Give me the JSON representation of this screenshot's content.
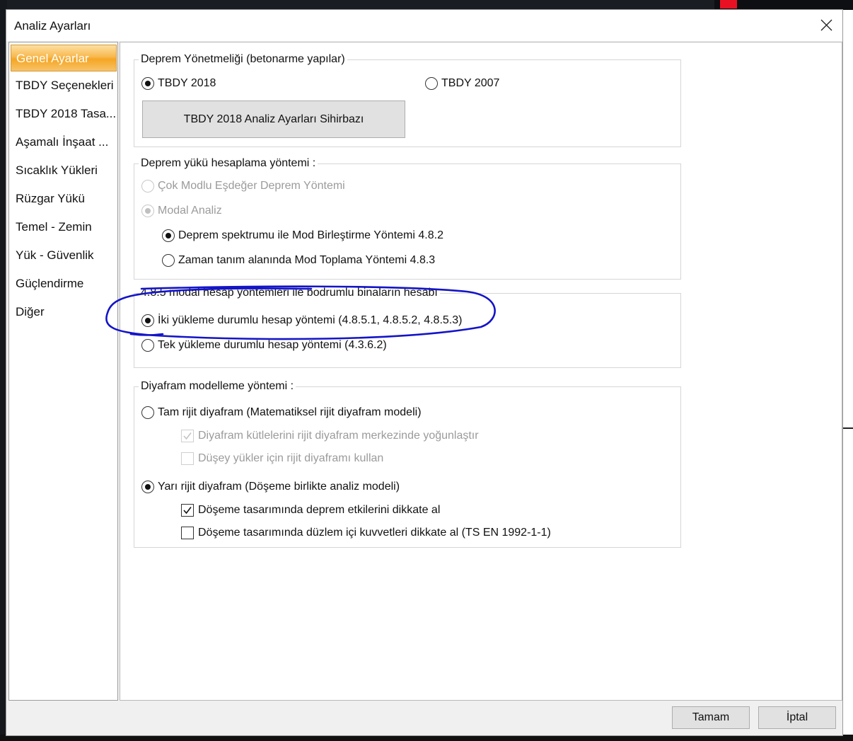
{
  "dialog": {
    "title": "Analiz Ayarları"
  },
  "sidebar": {
    "items": [
      {
        "label": "Genel Ayarlar",
        "active": true
      },
      {
        "label": "TBDY Seçenekleri"
      },
      {
        "label": "TBDY 2018 Tasa..."
      },
      {
        "label": "Aşamalı İnşaat ..."
      },
      {
        "label": "Sıcaklık Yükleri"
      },
      {
        "label": "Rüzgar Yükü"
      },
      {
        "label": "Temel - Zemin"
      },
      {
        "label": "Yük - Güvenlik"
      },
      {
        "label": "Güçlendirme"
      },
      {
        "label": "Diğer"
      }
    ]
  },
  "regulation": {
    "legend": "Deprem Yönetmeliği (betonarme yapılar)",
    "opt_2018": "TBDY 2018",
    "opt_2007": "TBDY 2007",
    "selected": "TBDY 2018",
    "wizard_button": "TBDY 2018 Analiz Ayarları Sihirbazı"
  },
  "seismic_method": {
    "legend": "Deprem yükü hesaplama yöntemi :",
    "opt_equivalent": "Çok Modlu Eşdeğer Deprem Yöntemi",
    "opt_modal": "Modal Analiz",
    "opt_spectrum": "Deprem spektrumu ile Mod Birleştirme Yöntemi 4.8.2",
    "opt_time": "Zaman tanım alanında Mod Toplama Yöntemi 4.8.3"
  },
  "basement": {
    "legend": "4.8.5 modal hesap yöntemleri ile bodrumlu binaların hesabı",
    "opt_two": "İki yükleme durumlu hesap yöntemi (4.8.5.1, 4.8.5.2, 4.8.5.3)",
    "opt_single": "Tek yükleme durumlu hesap yöntemi (4.3.6.2)"
  },
  "diaphragm": {
    "legend": "Diyafram modelleme yöntemi  :",
    "opt_rigid": "Tam rijit diyafram (Matematiksel rijit diyafram modeli)",
    "chk_mass": "Diyafram kütlelerini rijit diyafram merkezinde yoğunlaştır",
    "chk_vertical": "Düşey yükler için rijit diyaframı kullan",
    "opt_semi": "Yarı rijit diyafram (Döşeme birlikte analiz modeli)",
    "chk_seismic": "Döşeme tasarımında deprem etkilerini dikkate al",
    "chk_inplane": "Döşeme tasarımında düzlem içi kuvvetleri dikkate al (TS EN 1992-1-1)"
  },
  "footer": {
    "ok": "Tamam",
    "cancel": "İptal"
  },
  "colors": {
    "annotation": "#1414c8",
    "active_tab": "#f5a623"
  }
}
